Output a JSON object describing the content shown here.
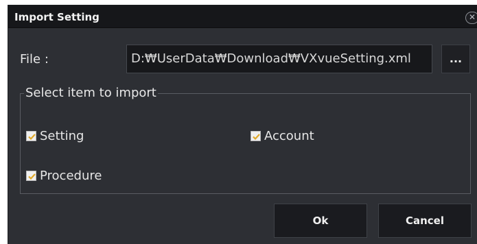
{
  "dialog": {
    "title": "Import Setting",
    "close_icon": "close-icon"
  },
  "file": {
    "label": "File :",
    "value": "D:₩UserData₩Download₩VXvueSetting.xml",
    "browse_label": "..."
  },
  "import_group": {
    "legend": "Select item to import",
    "items": [
      {
        "label": "Setting",
        "checked": true
      },
      {
        "label": "Account",
        "checked": true
      },
      {
        "label": "Procedure",
        "checked": true
      }
    ]
  },
  "buttons": {
    "ok_label": "Ok",
    "cancel_label": "Cancel"
  },
  "colors": {
    "check_mark": "#e0a92a",
    "dialog_bg": "#2d2f34",
    "titlebar_bg": "#16171a"
  }
}
